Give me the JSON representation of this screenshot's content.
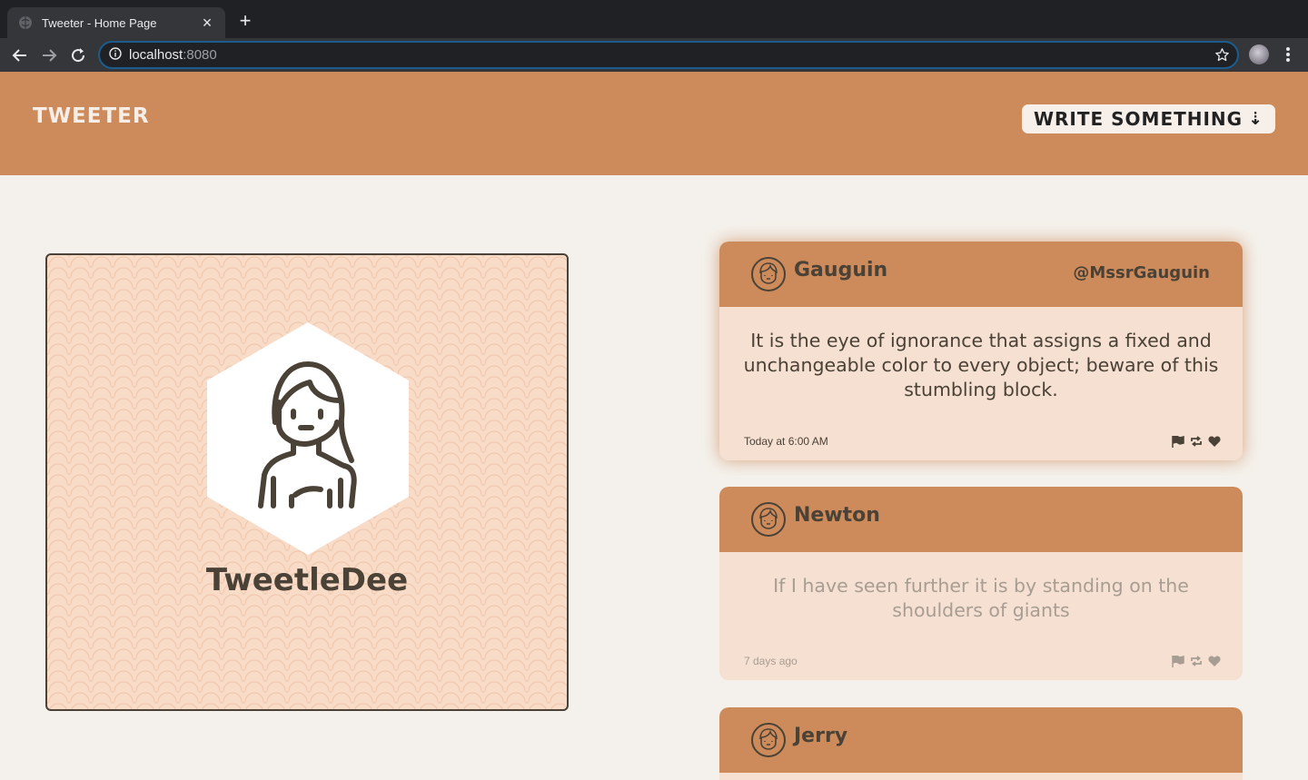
{
  "browser": {
    "tab_title": "Tweeter - Home Page",
    "tab_close": "×",
    "new_tab": "+",
    "url_host": "localhost",
    "url_port": ":8080"
  },
  "header": {
    "brand": "Tweeter",
    "write_button": "Write something",
    "write_arrow": "⇣"
  },
  "profile": {
    "name": "TweetleDee"
  },
  "tweets": [
    {
      "name": "Gauguin",
      "handle": "@MssrGauguin",
      "text": "It is the eye of ignorance that assigns a fixed and unchangeable color to every object; beware of this stumbling block.",
      "time": "Today at 6:00 AM"
    },
    {
      "name": "Newton",
      "handle": "",
      "text": "If I have seen further it is by standing on the shoulders of giants",
      "time": "7 days ago"
    },
    {
      "name": "Jerry",
      "handle": "",
      "text": "",
      "time": ""
    }
  ],
  "colors": {
    "header_bg": "#cd8b5b",
    "page_bg": "#f4f1ec",
    "card_bg": "#f6e0d2",
    "text_dark": "#4a4236"
  },
  "icons": [
    "flag-icon",
    "retweet-icon",
    "heart-icon",
    "star-icon",
    "reload-icon",
    "back-icon",
    "forward-icon",
    "info-icon"
  ]
}
